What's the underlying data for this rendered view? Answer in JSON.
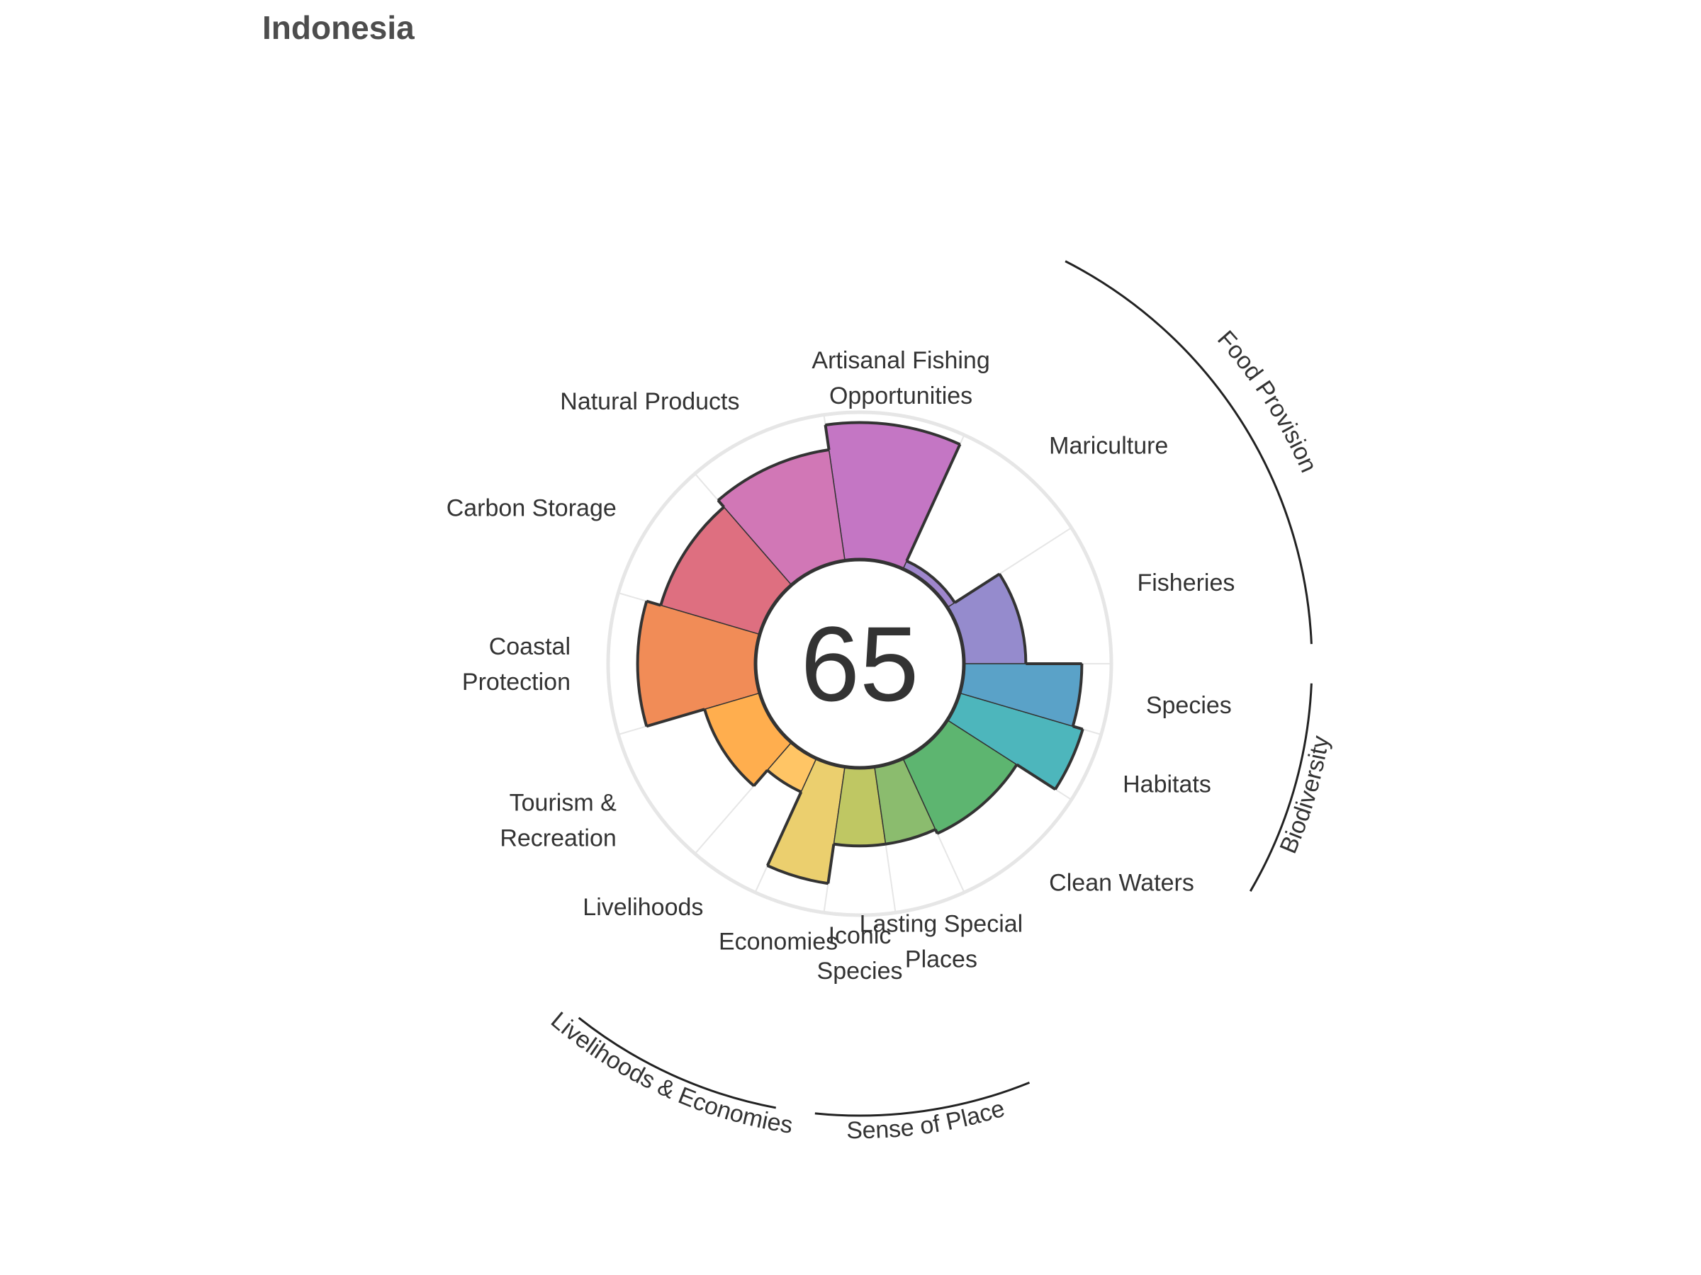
{
  "title": "Indonesia",
  "chart_data": {
    "type": "flower",
    "title": "Indonesia",
    "overall_score": 65,
    "ylim": [
      0,
      100
    ],
    "petals": [
      {
        "id": "fisheries",
        "label_lines": [
          "Fisheries"
        ],
        "value": 42,
        "weight": 1,
        "color": "#958bcd"
      },
      {
        "id": "mariculture",
        "label_lines": [
          "Mariculture"
        ],
        "value": 6,
        "weight": 1,
        "color": "#9f86cc"
      },
      {
        "id": "artisanal",
        "label_lines": [
          "Artisanal Fishing",
          "Opportunities"
        ],
        "value": 93,
        "weight": 1,
        "color": "#c476c4"
      },
      {
        "id": "natural_products",
        "label_lines": [
          "Natural Products"
        ],
        "value": 76,
        "weight": 1,
        "color": "#d177b6"
      },
      {
        "id": "carbon",
        "label_lines": [
          "Carbon Storage"
        ],
        "value": 70,
        "weight": 1,
        "color": "#de6f80"
      },
      {
        "id": "coastal",
        "label_lines": [
          "Coastal",
          "Protection"
        ],
        "value": 80,
        "weight": 1,
        "color": "#f18c57"
      },
      {
        "id": "tourism",
        "label_lines": [
          "Tourism &",
          "Recreation"
        ],
        "value": 39,
        "weight": 1,
        "color": "#ffae4e"
      },
      {
        "id": "livelihoods",
        "label_lines": [
          "Livelihoods"
        ],
        "value": 25,
        "weight": 0.5,
        "color": "#ffc565"
      },
      {
        "id": "economies",
        "label_lines": [
          "Economies"
        ],
        "value": 80,
        "weight": 0.5,
        "color": "#ebcf6e"
      },
      {
        "id": "iconic",
        "label_lines": [
          "Iconic",
          "Species"
        ],
        "value": 53,
        "weight": 0.5,
        "color": "#bfc763"
      },
      {
        "id": "lasting",
        "label_lines": [
          "Lasting Special",
          "Places"
        ],
        "value": 53,
        "weight": 0.5,
        "color": "#8bbc6e"
      },
      {
        "id": "clean_waters",
        "label_lines": [
          "Clean Waters"
        ],
        "value": 56,
        "weight": 1,
        "color": "#5db570"
      },
      {
        "id": "habitats",
        "label_lines": [
          "Habitats"
        ],
        "value": 87,
        "weight": 0.5,
        "color": "#4db6bc"
      },
      {
        "id": "species",
        "label_lines": [
          "Species"
        ],
        "value": 80,
        "weight": 0.5,
        "color": "#5aa2c8"
      }
    ],
    "groups": [
      {
        "id": "food_provision",
        "label": "Food Provision",
        "from": "fisheries",
        "to": "mariculture"
      },
      {
        "id": "biodiversity",
        "label": "Biodiversity",
        "from": "habitats",
        "to": "species"
      },
      {
        "id": "sense_of_place",
        "label": "Sense of Place",
        "from": "iconic",
        "to": "lasting"
      },
      {
        "id": "livelihoods_economies",
        "label": "Livelihoods & Economies",
        "from": "livelihoods",
        "to": "economies"
      }
    ]
  }
}
